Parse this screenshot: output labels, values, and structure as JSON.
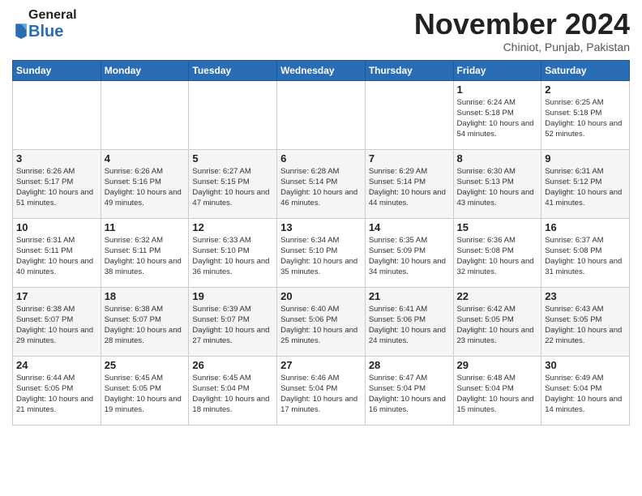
{
  "logo": {
    "general": "General",
    "blue": "Blue"
  },
  "header": {
    "month": "November 2024",
    "location": "Chiniot, Punjab, Pakistan"
  },
  "weekdays": [
    "Sunday",
    "Monday",
    "Tuesday",
    "Wednesday",
    "Thursday",
    "Friday",
    "Saturday"
  ],
  "weeks": [
    [
      {
        "day": "",
        "info": ""
      },
      {
        "day": "",
        "info": ""
      },
      {
        "day": "",
        "info": ""
      },
      {
        "day": "",
        "info": ""
      },
      {
        "day": "",
        "info": ""
      },
      {
        "day": "1",
        "info": "Sunrise: 6:24 AM\nSunset: 5:18 PM\nDaylight: 10 hours\nand 54 minutes."
      },
      {
        "day": "2",
        "info": "Sunrise: 6:25 AM\nSunset: 5:18 PM\nDaylight: 10 hours\nand 52 minutes."
      }
    ],
    [
      {
        "day": "3",
        "info": "Sunrise: 6:26 AM\nSunset: 5:17 PM\nDaylight: 10 hours\nand 51 minutes."
      },
      {
        "day": "4",
        "info": "Sunrise: 6:26 AM\nSunset: 5:16 PM\nDaylight: 10 hours\nand 49 minutes."
      },
      {
        "day": "5",
        "info": "Sunrise: 6:27 AM\nSunset: 5:15 PM\nDaylight: 10 hours\nand 47 minutes."
      },
      {
        "day": "6",
        "info": "Sunrise: 6:28 AM\nSunset: 5:14 PM\nDaylight: 10 hours\nand 46 minutes."
      },
      {
        "day": "7",
        "info": "Sunrise: 6:29 AM\nSunset: 5:14 PM\nDaylight: 10 hours\nand 44 minutes."
      },
      {
        "day": "8",
        "info": "Sunrise: 6:30 AM\nSunset: 5:13 PM\nDaylight: 10 hours\nand 43 minutes."
      },
      {
        "day": "9",
        "info": "Sunrise: 6:31 AM\nSunset: 5:12 PM\nDaylight: 10 hours\nand 41 minutes."
      }
    ],
    [
      {
        "day": "10",
        "info": "Sunrise: 6:31 AM\nSunset: 5:11 PM\nDaylight: 10 hours\nand 40 minutes."
      },
      {
        "day": "11",
        "info": "Sunrise: 6:32 AM\nSunset: 5:11 PM\nDaylight: 10 hours\nand 38 minutes."
      },
      {
        "day": "12",
        "info": "Sunrise: 6:33 AM\nSunset: 5:10 PM\nDaylight: 10 hours\nand 36 minutes."
      },
      {
        "day": "13",
        "info": "Sunrise: 6:34 AM\nSunset: 5:10 PM\nDaylight: 10 hours\nand 35 minutes."
      },
      {
        "day": "14",
        "info": "Sunrise: 6:35 AM\nSunset: 5:09 PM\nDaylight: 10 hours\nand 34 minutes."
      },
      {
        "day": "15",
        "info": "Sunrise: 6:36 AM\nSunset: 5:08 PM\nDaylight: 10 hours\nand 32 minutes."
      },
      {
        "day": "16",
        "info": "Sunrise: 6:37 AM\nSunset: 5:08 PM\nDaylight: 10 hours\nand 31 minutes."
      }
    ],
    [
      {
        "day": "17",
        "info": "Sunrise: 6:38 AM\nSunset: 5:07 PM\nDaylight: 10 hours\nand 29 minutes."
      },
      {
        "day": "18",
        "info": "Sunrise: 6:38 AM\nSunset: 5:07 PM\nDaylight: 10 hours\nand 28 minutes."
      },
      {
        "day": "19",
        "info": "Sunrise: 6:39 AM\nSunset: 5:07 PM\nDaylight: 10 hours\nand 27 minutes."
      },
      {
        "day": "20",
        "info": "Sunrise: 6:40 AM\nSunset: 5:06 PM\nDaylight: 10 hours\nand 25 minutes."
      },
      {
        "day": "21",
        "info": "Sunrise: 6:41 AM\nSunset: 5:06 PM\nDaylight: 10 hours\nand 24 minutes."
      },
      {
        "day": "22",
        "info": "Sunrise: 6:42 AM\nSunset: 5:05 PM\nDaylight: 10 hours\nand 23 minutes."
      },
      {
        "day": "23",
        "info": "Sunrise: 6:43 AM\nSunset: 5:05 PM\nDaylight: 10 hours\nand 22 minutes."
      }
    ],
    [
      {
        "day": "24",
        "info": "Sunrise: 6:44 AM\nSunset: 5:05 PM\nDaylight: 10 hours\nand 21 minutes."
      },
      {
        "day": "25",
        "info": "Sunrise: 6:45 AM\nSunset: 5:05 PM\nDaylight: 10 hours\nand 19 minutes."
      },
      {
        "day": "26",
        "info": "Sunrise: 6:45 AM\nSunset: 5:04 PM\nDaylight: 10 hours\nand 18 minutes."
      },
      {
        "day": "27",
        "info": "Sunrise: 6:46 AM\nSunset: 5:04 PM\nDaylight: 10 hours\nand 17 minutes."
      },
      {
        "day": "28",
        "info": "Sunrise: 6:47 AM\nSunset: 5:04 PM\nDaylight: 10 hours\nand 16 minutes."
      },
      {
        "day": "29",
        "info": "Sunrise: 6:48 AM\nSunset: 5:04 PM\nDaylight: 10 hours\nand 15 minutes."
      },
      {
        "day": "30",
        "info": "Sunrise: 6:49 AM\nSunset: 5:04 PM\nDaylight: 10 hours\nand 14 minutes."
      }
    ]
  ]
}
